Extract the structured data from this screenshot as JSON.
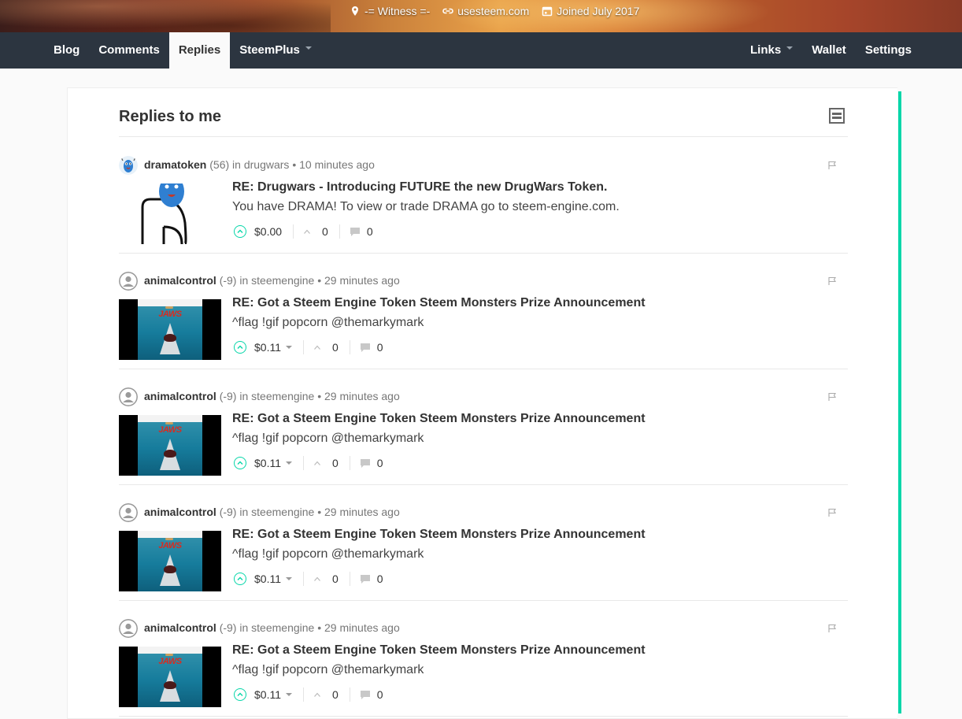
{
  "profile": {
    "location": "-= Witness =-",
    "website": "usesteem.com",
    "joined": "Joined July 2017"
  },
  "nav": {
    "left": [
      {
        "label": "Blog",
        "active": false
      },
      {
        "label": "Comments",
        "active": false
      },
      {
        "label": "Replies",
        "active": true
      },
      {
        "label": "SteemPlus",
        "active": false,
        "dropdown": true
      }
    ],
    "right": [
      {
        "label": "Links",
        "dropdown": true
      },
      {
        "label": "Wallet"
      },
      {
        "label": "Settings"
      }
    ]
  },
  "page": {
    "title": "Replies to me"
  },
  "colors": {
    "accent": "#06d6a9",
    "navbar": "#2c3540"
  },
  "replies": [
    {
      "author": "dramatoken",
      "rep": "(56)",
      "in_label": "in",
      "community": "drugwars",
      "time": "• 10 minutes ago",
      "title": "RE: Drugwars - Introducing FUTURE the new DrugWars Token.",
      "body": "You have DRAMA! To view or trade DRAMA go to steem-engine.com.",
      "payout": "$0.00",
      "votes": "0",
      "comments": "0",
      "avatar": "drama-avatar",
      "thumb": "drama"
    },
    {
      "author": "animalcontrol",
      "rep": "(-9)",
      "in_label": "in",
      "community": "steemengine",
      "time": "• 29 minutes ago",
      "title": "RE: Got a Steem Engine Token Steem Monsters Prize Announcement",
      "body": "^flag !gif popcorn @themarkymark",
      "payout": "$0.11",
      "votes": "0",
      "comments": "0",
      "avatar": "default-avatar",
      "thumb": "jaws"
    },
    {
      "author": "animalcontrol",
      "rep": "(-9)",
      "in_label": "in",
      "community": "steemengine",
      "time": "• 29 minutes ago",
      "title": "RE: Got a Steem Engine Token Steem Monsters Prize Announcement",
      "body": "^flag !gif popcorn @themarkymark",
      "payout": "$0.11",
      "votes": "0",
      "comments": "0",
      "avatar": "default-avatar",
      "thumb": "jaws"
    },
    {
      "author": "animalcontrol",
      "rep": "(-9)",
      "in_label": "in",
      "community": "steemengine",
      "time": "• 29 minutes ago",
      "title": "RE: Got a Steem Engine Token Steem Monsters Prize Announcement",
      "body": "^flag !gif popcorn @themarkymark",
      "payout": "$0.11",
      "votes": "0",
      "comments": "0",
      "avatar": "default-avatar",
      "thumb": "jaws"
    },
    {
      "author": "animalcontrol",
      "rep": "(-9)",
      "in_label": "in",
      "community": "steemengine",
      "time": "• 29 minutes ago",
      "title": "RE: Got a Steem Engine Token Steem Monsters Prize Announcement",
      "body": "^flag !gif popcorn @themarkymark",
      "payout": "$0.11",
      "votes": "0",
      "comments": "0",
      "avatar": "default-avatar",
      "thumb": "jaws"
    }
  ],
  "jaws_title": "JAWS"
}
